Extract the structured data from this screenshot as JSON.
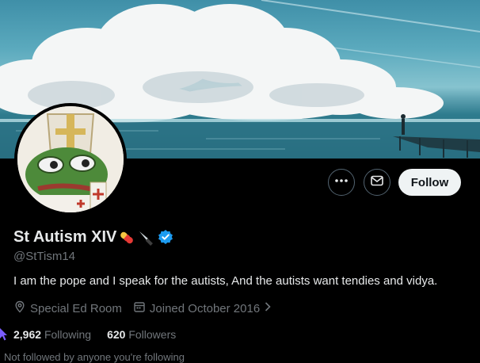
{
  "profile": {
    "display_name": "St Autism XIV",
    "name_emojis": [
      "pill-emoji",
      "knife-emoji"
    ],
    "verified_badge": "verified-badge-icon",
    "handle": "@StTism14",
    "bio": "I am the pope and I speak for the autists, And the autists want tendies and vidya.",
    "location": "Special Ed Room",
    "joined": "Joined October 2016",
    "following_count": "2,962",
    "following_label": "Following",
    "followers_count": "620",
    "followers_label": "Followers",
    "followed_by_text": "Not followed by anyone you're following"
  },
  "actions": {
    "more_icon": "more-dots-icon",
    "message_icon": "mail-icon",
    "follow_label": "Follow"
  },
  "colors": {
    "background": "#000000",
    "text_primary": "#e7e9ea",
    "text_secondary": "#71767b",
    "verified_blue": "#1d9bf0",
    "follow_button_bg": "#eff3f4"
  }
}
